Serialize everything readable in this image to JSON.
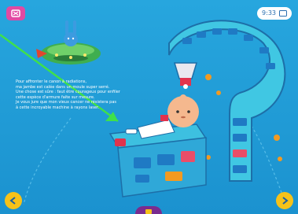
{
  "story": {
    "lines": [
      "Pour affronter le canon à radiations,",
      "ma jambe est calée dans un moule super serré.",
      "Une chose est sûre : faut être courageux pour enfiler",
      "cette espèce d'armure faite sur mesure.",
      "Je vous jure que mon vieux cancer ne résistera pas",
      "à cette incroyable machine à rayons laser."
    ]
  },
  "hud": {
    "time": "9:33"
  },
  "icons": {
    "home": "home-icon",
    "prev": "arrow-left-icon",
    "next": "arrow-right-icon",
    "menu": "menu-tab-icon"
  },
  "colors": {
    "background": "#1f9bd6",
    "home_button": "#e14aa3",
    "nav_buttons": "#f6c219",
    "pointer_line": "#3fe04a"
  }
}
